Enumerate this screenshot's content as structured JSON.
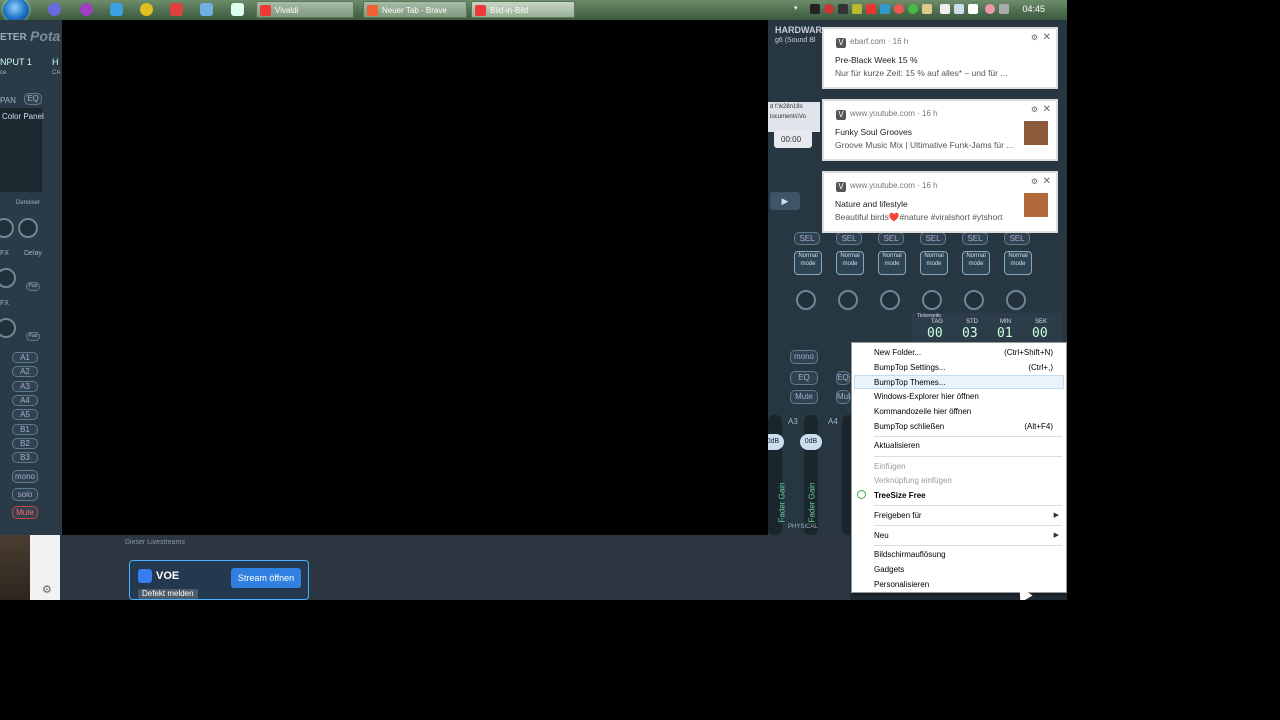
{
  "taskbar": {
    "tasks": [
      {
        "label": "Vivaldi"
      },
      {
        "label": "Neuer Tab - Brave"
      },
      {
        "label": "Bild-in-Bild"
      }
    ],
    "clock": "04:45"
  },
  "voicemeeter": {
    "left_labels": [
      "ETER",
      "NPUT 1",
      "PAN",
      "EQ",
      "Color Panel",
      "Denoiser",
      "Delay",
      "FX",
      "Pad",
      "Pad",
      "mono",
      "solo",
      "Mute"
    ],
    "buses": [
      "A1",
      "A2",
      "A3",
      "A4",
      "A5",
      "B1",
      "B2",
      "B3"
    ],
    "header_text": "HARDWAR",
    "header_sub": "g6 (Sound Bl",
    "sel": "SEL",
    "normal_mode": "Normal mode",
    "mono": "mono",
    "eq": "EQ",
    "mute": "Mute",
    "fader_gain": "Fader Gain",
    "db": "0dB",
    "a3": "A3",
    "a4": "A4",
    "physical": "PHYSICAL",
    "time_stamp": "00:00"
  },
  "bottom": {
    "strip_text": "Dieser Livestreams",
    "voe_name": "VOE",
    "stream_button": "Stream öffnen",
    "defect_button": "Defekt melden"
  },
  "notifications": [
    {
      "source": "ebarf.com · 16 h",
      "title": "Pre-Black Week 15 %",
      "body": "Nur für kurze Zeit: 15 % auf alles* – und für ...",
      "thumb_color": "#ffffff"
    },
    {
      "source": "www.youtube.com · 16 h",
      "title": "Funky Soul Grooves",
      "body": "Groove Music Mix | Ultimative Funk-Jams für ...",
      "thumb_color": "#8a5a3a"
    },
    {
      "source": "www.youtube.com · 16 h",
      "title": "Nature and lifestyle",
      "body": "Beautiful birds❤️#nature #viralshort #ytshort",
      "thumb_color": "#b06a3a"
    }
  ],
  "time_widget": {
    "caption": "Tickerseite",
    "labels": [
      "TAG",
      "STD",
      "MIN",
      "SEK"
    ],
    "values": [
      "00",
      "03",
      "01",
      "00"
    ]
  },
  "context_menu": {
    "items": [
      {
        "label": "New Folder...",
        "shortcut": "(Ctrl+Shift+N)"
      },
      {
        "label": "BumpTop Settings...",
        "shortcut": "(Ctrl+,)"
      },
      {
        "label": "BumpTop Themes...",
        "shortcut": ""
      },
      {
        "label": "Windows-Explorer hier öffnen",
        "shortcut": ""
      },
      {
        "label": "Kommandozeile hier öffnen",
        "shortcut": ""
      },
      {
        "label": "BumpTop schließen",
        "shortcut": "(Alt+F4)"
      },
      {
        "label": "Aktualisieren",
        "shortcut": ""
      },
      {
        "label": "Einfügen",
        "shortcut": ""
      },
      {
        "label": "Verknüpfung einfügen",
        "shortcut": ""
      },
      {
        "label": "TreeSize Free",
        "shortcut": ""
      },
      {
        "label": "Freigeben für",
        "shortcut": ""
      },
      {
        "label": "Neu",
        "shortcut": ""
      },
      {
        "label": "Bildschirmauflösung",
        "shortcut": ""
      },
      {
        "label": "Gadgets",
        "shortcut": ""
      },
      {
        "label": "Personalisieren",
        "shortcut": ""
      }
    ]
  }
}
